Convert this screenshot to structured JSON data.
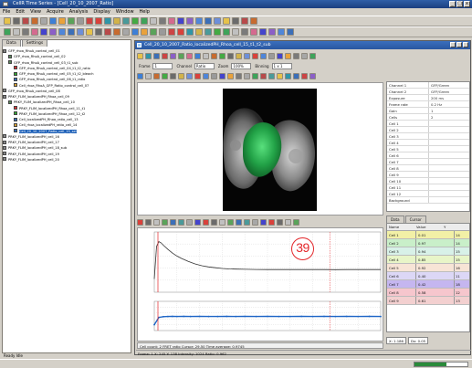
{
  "window": {
    "title": "CellR Time Series - [Cell_20_10_2007_Ratio]"
  },
  "menu": [
    "File",
    "Edit",
    "View",
    "Acquire",
    "Analysis",
    "Display",
    "Window",
    "Help"
  ],
  "left_panel": {
    "tabs": [
      "Data",
      "Settings"
    ],
    "tree": [
      {
        "indent": 0,
        "label": "GFP_rhoa_RhoA_control_cell_01",
        "color": "#8a8a8a",
        "selected": false
      },
      {
        "indent": 1,
        "label": "GFP_rhoa_RhoA_control_cell_02",
        "color": "#5a8a5a",
        "selected": false
      },
      {
        "indent": 1,
        "label": "GFP_rhoa_RhoA_control_cell_03_t1_sub",
        "color": "#5a8a5a",
        "selected": false
      },
      {
        "indent": 2,
        "label": "GFP_rhoa_RhoA_control_cell_04_t1_t2_ratio",
        "color": "#d33",
        "selected": false
      },
      {
        "indent": 2,
        "label": "GFP_rhoa_RhoA_control_cell_05_t1_t2_bleach",
        "color": "#3a3",
        "selected": false
      },
      {
        "indent": 2,
        "label": "GFP_rhoa_RhoA_control_cell_06_t1_ratio",
        "color": "#3370c0",
        "selected": false
      },
      {
        "indent": 2,
        "label": "Cell_rhoa_RhoA_GFP_Ratio_control_cell_07",
        "color": "#dca230",
        "selected": false
      },
      {
        "indent": 0,
        "label": "GFP_rhoa_RhoA_control_cell_08",
        "color": "#8a8a8a",
        "selected": false
      },
      {
        "indent": 0,
        "label": "PRKY_FLIM_localizedPH_Rhoa_cell_09",
        "color": "#8a8a8a",
        "selected": false
      },
      {
        "indent": 1,
        "label": "PRKY_FLIM_localizedPH_Rhoa_cell_10",
        "color": "#5a8a5a",
        "selected": false
      },
      {
        "indent": 2,
        "label": "PRKY_FLIM_localizedPH_Rhoa_cell_11_t1",
        "color": "#d33",
        "selected": false
      },
      {
        "indent": 2,
        "label": "PRKY_FLIM_localizedPH_Rhoa_cell_12_t2",
        "color": "#3a3",
        "selected": false
      },
      {
        "indent": 2,
        "label": "Cell_localizedPH_Rhoa_ratio_cell_13",
        "color": "#3370c0",
        "selected": false
      },
      {
        "indent": 2,
        "label": "Cell_rhoa_localizedPH_ratio_cell_14",
        "color": "#dca230",
        "selected": false
      },
      {
        "indent": 2,
        "label": "Cell_20_10_2007_Ratio_cell_15_sel",
        "color": "#3370c0",
        "selected": true
      },
      {
        "indent": 0,
        "label": "PRKY_FLIM_localizedPH_cell_16",
        "color": "#8a8a8a",
        "selected": false
      },
      {
        "indent": 0,
        "label": "PRKY_FLIM_localizedPH_cell_17",
        "color": "#8a8a8a",
        "selected": false
      },
      {
        "indent": 0,
        "label": "PRKY_FLIM_localizedPH_cell_18_sub",
        "color": "#8a8a8a",
        "selected": false
      },
      {
        "indent": 0,
        "label": "PRKY_FLIM_localizedPH_cell_19",
        "color": "#8a8a8a",
        "selected": false
      },
      {
        "indent": 0,
        "label": "PRKY_FLIM_localizedPH_cell_20",
        "color": "#8a8a8a",
        "selected": false
      }
    ],
    "status": "Ready  Idle"
  },
  "child_window": {
    "title": "Cell_20_10_2007_Ratio_localizedPH_Rhoa_cell_15_t1_t2_sub"
  },
  "image_toolbar": {
    "frame_label": "Frame",
    "frame_value": "1",
    "channel_label": "Channel",
    "channel_value": "Ratio",
    "zoom_label": "Zoom",
    "zoom_value": "100%",
    "binning_label": "Binning",
    "binning_value": "1 x 1"
  },
  "properties": [
    {
      "key": "Channel 1",
      "value": "GFP/Green"
    },
    {
      "key": "Channel 2",
      "value": "GFP/Green"
    },
    {
      "key": "Exposure",
      "value": "200 ms"
    },
    {
      "key": "Frame rate",
      "value": "0.2 Hz"
    },
    {
      "key": "Gain",
      "value": "1"
    },
    {
      "key": "Cells",
      "value": "2"
    },
    {
      "key": "Cell 1",
      "value": ""
    },
    {
      "key": "Cell 2",
      "value": ""
    },
    {
      "key": "Cell 3",
      "value": ""
    },
    {
      "key": "Cell 4",
      "value": ""
    },
    {
      "key": "Cell 5",
      "value": ""
    },
    {
      "key": "Cell 6",
      "value": ""
    },
    {
      "key": "Cell 7",
      "value": ""
    },
    {
      "key": "Cell 8",
      "value": ""
    },
    {
      "key": "Cell 9",
      "value": ""
    },
    {
      "key": "Cell 10",
      "value": ""
    },
    {
      "key": "Cell 11",
      "value": ""
    },
    {
      "key": "Cell 12",
      "value": ""
    },
    {
      "key": "Background",
      "value": ""
    }
  ],
  "legend": {
    "tabs": [
      "Data",
      "Cursor"
    ],
    "headers": [
      "Name",
      "Value",
      "Y"
    ],
    "rows": [
      {
        "name": "Cell 1",
        "value": "0.01",
        "y": "14",
        "color": "#f2f0a6"
      },
      {
        "name": "Cell 2",
        "value": "0.97",
        "y": "14",
        "color": "#c9efc9"
      },
      {
        "name": "Cell 3",
        "value": "0.94",
        "y": "15",
        "color": "#d8f1e8"
      },
      {
        "name": "Cell 4",
        "value": "0.85",
        "y": "15",
        "color": "#e8f5c8"
      },
      {
        "name": "Cell 5",
        "value": "0.92",
        "y": "16",
        "color": "#f7e4d6"
      },
      {
        "name": "Cell 6",
        "value": "0.40",
        "y": "11",
        "color": "#dcd7f6"
      },
      {
        "name": "Cell 7",
        "value": "0.42",
        "y": "18",
        "color": "#c5b6f0"
      },
      {
        "name": "Cell 8",
        "value": "0.58",
        "y": "12",
        "color": "#f6c6cd"
      },
      {
        "name": "Cell 9",
        "value": "0.61",
        "y": "13",
        "color": "#f3d0d0"
      }
    ]
  },
  "badge_number": "39",
  "cursor": {
    "x": "X: 1.186",
    "dx": "Dx: 0.05"
  },
  "graph": {
    "status": "Cell count: 2  FRET ratio  Cursor: 29.50  Time average: 0.9745"
  },
  "child_status": "Frame: 1  X: 245  Y: 138  Intensity: 1024  Ratio: 0.962",
  "app_progress": 0.6,
  "colors": {
    "trace_top": "#333333",
    "trace_bottom": "#1f66c6",
    "cursor_red": "#e3262a",
    "grid": "#d6d6d6",
    "cell_green": "#2fae55",
    "badge_red": "#e3262a"
  },
  "chart_data": [
    {
      "type": "line",
      "title": "",
      "xlabel": "",
      "ylabel": "",
      "series": [
        {
          "x": [
            0,
            1,
            2,
            3,
            4,
            6,
            8,
            10,
            12,
            15,
            18,
            21,
            24,
            27,
            30,
            33,
            36,
            40,
            45,
            50,
            55,
            60,
            65,
            70,
            75,
            80,
            85,
            90,
            95,
            100
          ],
          "values": [
            1.1,
            3.8,
            4.2,
            4.1,
            3.9,
            3.55,
            3.25,
            3.0,
            2.8,
            2.55,
            2.35,
            2.2,
            2.1,
            2.03,
            1.97,
            1.93,
            1.92,
            1.9,
            1.89,
            1.88,
            1.88,
            1.88,
            1.88,
            1.88,
            1.88,
            1.87,
            1.88,
            1.88,
            1.88,
            1.88
          ]
        }
      ],
      "xlim": [
        0,
        100
      ],
      "ylim": [
        0,
        5
      ],
      "grid": true
    },
    {
      "type": "line",
      "title": "",
      "xlabel": "",
      "ylabel": "",
      "series": [
        {
          "x": [
            0,
            2,
            4,
            6,
            8,
            10,
            13,
            16,
            20,
            24,
            28,
            32,
            36,
            40,
            45,
            50,
            55,
            60,
            65,
            70,
            75,
            80,
            85,
            90,
            95,
            100
          ],
          "values": [
            0.4,
            0.9,
            0.95,
            0.96,
            0.97,
            0.96,
            0.97,
            0.96,
            0.97,
            0.96,
            0.96,
            0.97,
            0.96,
            0.97,
            0.96,
            0.97,
            0.96,
            0.96,
            0.97,
            0.96,
            0.97,
            0.96,
            0.97,
            0.96,
            0.97,
            0.96
          ]
        }
      ],
      "xlim": [
        0,
        100
      ],
      "ylim": [
        0,
        2
      ],
      "grid": true
    }
  ]
}
